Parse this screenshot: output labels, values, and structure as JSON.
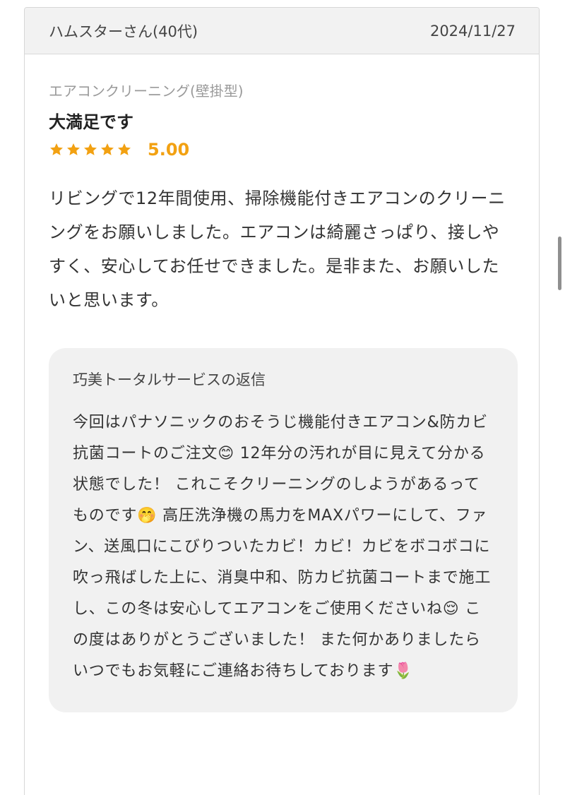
{
  "review": {
    "reviewer": "ハムスターさん(40代)",
    "date": "2024/11/27",
    "service": "エアコンクリーニング(壁掛型)",
    "title": "大満足です",
    "rating": {
      "score": "5.00",
      "stars": 5,
      "star_color": "#f2a112"
    },
    "comment": "リビングで12年間使用、掃除機能付きエアコンのクリーニングをお願いしました。エアコンは綺麗さっぱり、接しやすく、安心してお任せできました。是非また、お願いしたいと思います。"
  },
  "reply": {
    "title": "巧美トータルサービスの返信",
    "text": "今回はパナソニックのおそうじ機能付きエアコン&防カビ抗菌コートのご注文😊 12年分の汚れが目に見えて分かる状態でした！ これこそクリーニングのしようがあるってものです🤭 高圧洗浄機の馬力をMAXパワーにして、ファン、送風口にこびりついたカビ！カビ！カビをボコボコに吹っ飛ばした上に、消臭中和、防カビ抗菌コートまで施工し、この冬は安心してエアコンをご使用くださいね😌 この度はありがとうございました！ また何かありましたらいつでもお気軽にご連絡お待ちしております🌷"
  },
  "colors": {
    "accent": "#f2a112",
    "header_bg": "#f2f2f2",
    "reply_bg": "#f1f1f1"
  }
}
